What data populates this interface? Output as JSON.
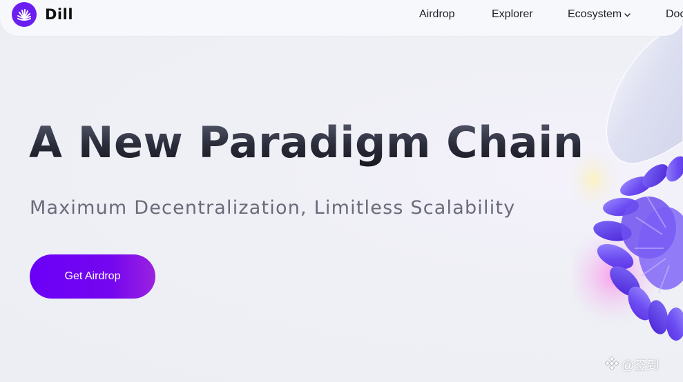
{
  "header": {
    "brand": "Dill",
    "nav": {
      "airdrop": "Airdrop",
      "explorer": "Explorer",
      "ecosystem": "Ecosystem",
      "docs": "Doc"
    }
  },
  "hero": {
    "title": "A New Paradigm Chain",
    "subtitle": "Maximum Decentralization, Limitless Scalability",
    "cta_label": "Get Airdrop"
  },
  "watermark": {
    "text": "@签到"
  },
  "colors": {
    "brand_purple": "#6a1ff0",
    "cta_gradient_start": "#6a00f7",
    "cta_gradient_end": "#9a22e0",
    "title_dark": "#1f2030",
    "subtitle_gray": "#6a6b7a"
  },
  "icons": {
    "logo": "dill-logo-icon",
    "dropdown": "chevron-down-icon",
    "watermark": "diamond-logo-icon"
  }
}
